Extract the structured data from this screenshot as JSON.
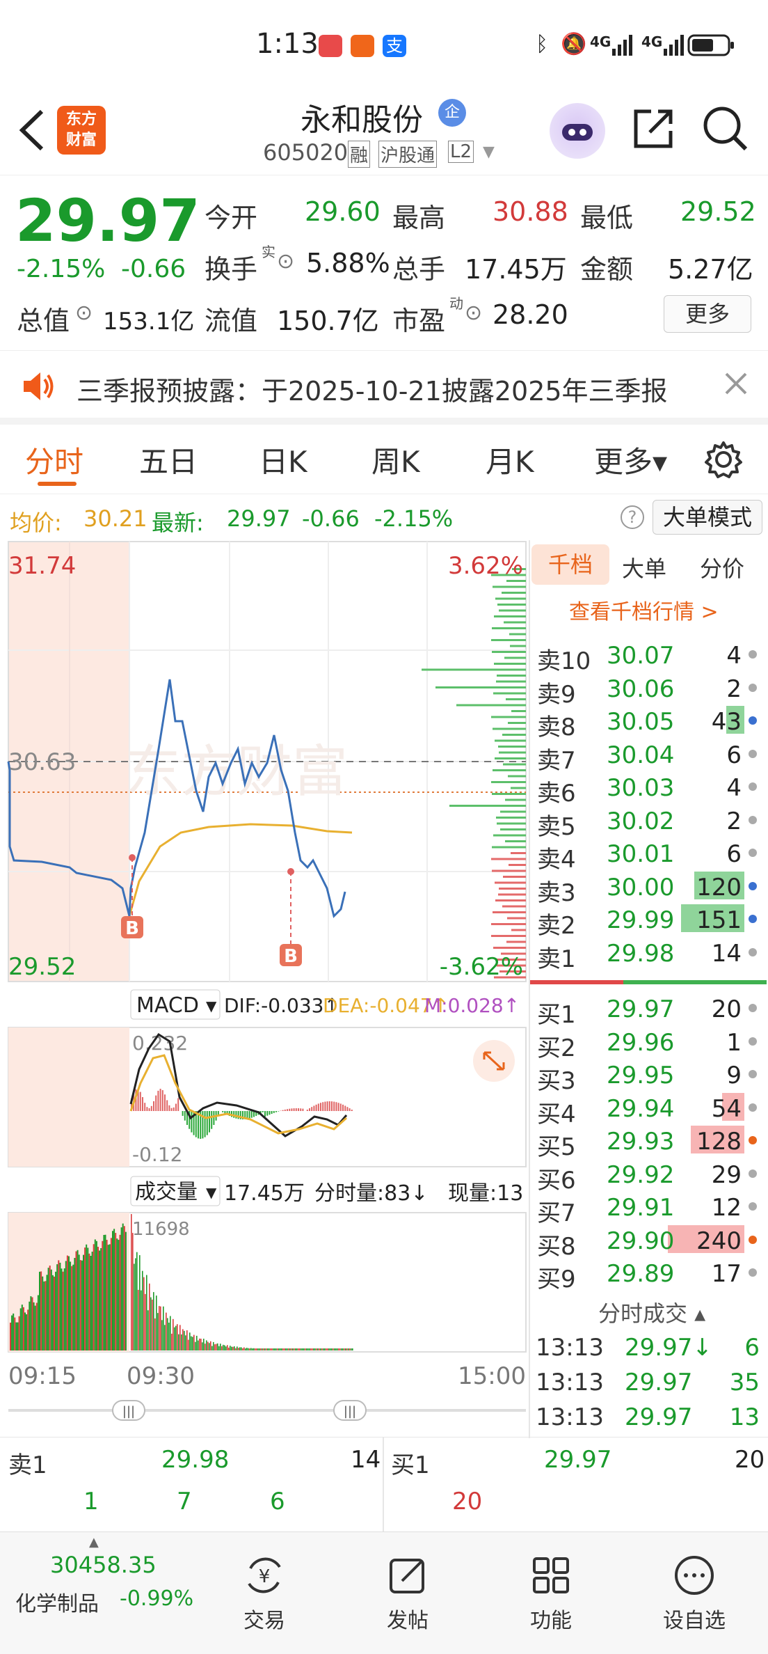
{
  "status": {
    "time": "1:13",
    "signal1": "4G",
    "signal2": "4G"
  },
  "nav": {
    "logo": "东方\n财富",
    "title": "永和股份",
    "corp_badge": "企",
    "code": "605020",
    "tag1": "融",
    "tag2": "沪股通",
    "tag3": "L2"
  },
  "quote": {
    "price": "29.97",
    "pct": "-2.15%",
    "chg": "-0.66",
    "open_label": "今开",
    "open": "29.60",
    "high_label": "最高",
    "high": "30.88",
    "low_label": "最低",
    "low": "29.52",
    "turnover_label": "换手",
    "turnover_sup": "实",
    "turnover": "5.88%",
    "volume_label": "总手",
    "volume": "17.45万",
    "amount_label": "金额",
    "amount": "5.27亿",
    "mcap_label": "总值",
    "mcap": "153.1亿",
    "float_label": "流值",
    "float": "150.7亿",
    "pe_label": "市盈",
    "pe_sup": "动",
    "pe": "28.20",
    "more": "更多"
  },
  "notice": {
    "text": "三季报预披露：于2025-10-21披露2025年三季报"
  },
  "tabs": [
    "分时",
    "五日",
    "日K",
    "周K",
    "月K",
    "更多▾"
  ],
  "subhdr": {
    "avg_label": "均价:",
    "avg": "30.21",
    "last_label": "最新:",
    "last": "29.97",
    "chg": "-0.66",
    "pct": "-2.15%",
    "big_order": "大单模式"
  },
  "chart": {
    "top_price": "31.74",
    "top_pct": "3.62%",
    "mid_price": "30.63",
    "bot_price": "29.52",
    "bot_pct": "-3.62%",
    "watermark": "东方财富",
    "macd_label": "MACD",
    "dif": "DIF:-0.033↑",
    "dea": "DEA:-0.047↑",
    "m": "M:0.028↑",
    "macd_top": "0.232",
    "macd_bot": "-0.12",
    "vol_label": "成交量",
    "vol_total": "17.45万",
    "vol_min": "分时量:83↓",
    "vol_now": "现量:13",
    "vol_max": "11698",
    "t1": "09:15",
    "t2": "09:30",
    "t3": "15:00",
    "b_label": "B"
  },
  "chart_data": {
    "type": "line",
    "title": "",
    "x": [
      "09:15",
      "09:30",
      "15:00"
    ],
    "ylim": [
      29.52,
      31.74
    ],
    "series": [
      {
        "name": "最新",
        "values": [
          30.63,
          30.18,
          30.12,
          30.05,
          29.6,
          30.48,
          30.4,
          30.25,
          30.05,
          29.88,
          29.97
        ]
      },
      {
        "name": "均价",
        "values": [
          29.7,
          30.1,
          30.21,
          30.21
        ]
      }
    ]
  },
  "orderbook": {
    "tabs": [
      "千档",
      "大单",
      "分价"
    ],
    "link": "查看千档行情 >",
    "asks": [
      {
        "label": "卖10",
        "price": "30.07",
        "qty": "4"
      },
      {
        "label": "卖9",
        "price": "30.06",
        "qty": "2"
      },
      {
        "label": "卖8",
        "price": "30.05",
        "qty": "43"
      },
      {
        "label": "卖7",
        "price": "30.04",
        "qty": "6"
      },
      {
        "label": "卖6",
        "price": "30.03",
        "qty": "4"
      },
      {
        "label": "卖5",
        "price": "30.02",
        "qty": "2"
      },
      {
        "label": "卖4",
        "price": "30.01",
        "qty": "6"
      },
      {
        "label": "卖3",
        "price": "30.00",
        "qty": "120"
      },
      {
        "label": "卖2",
        "price": "29.99",
        "qty": "151"
      },
      {
        "label": "卖1",
        "price": "29.98",
        "qty": "14"
      }
    ],
    "bids": [
      {
        "label": "买1",
        "price": "29.97",
        "qty": "20"
      },
      {
        "label": "买2",
        "price": "29.96",
        "qty": "1"
      },
      {
        "label": "买3",
        "price": "29.95",
        "qty": "9"
      },
      {
        "label": "买4",
        "price": "29.94",
        "qty": "54"
      },
      {
        "label": "买5",
        "price": "29.93",
        "qty": "128"
      },
      {
        "label": "买6",
        "price": "29.92",
        "qty": "29"
      },
      {
        "label": "买7",
        "price": "29.91",
        "qty": "12"
      },
      {
        "label": "买8",
        "price": "29.90",
        "qty": "240"
      },
      {
        "label": "买9",
        "price": "29.89",
        "qty": "17"
      }
    ],
    "trades_title": "分时成交 ▴",
    "trades": [
      {
        "time": "13:13",
        "price": "29.97↓",
        "qty": "6"
      },
      {
        "time": "13:13",
        "price": "29.97",
        "qty": "35"
      },
      {
        "time": "13:13",
        "price": "29.97",
        "qty": "13"
      }
    ]
  },
  "bottom": {
    "ask_label": "卖1",
    "ask_price": "29.98",
    "ask_qty": "14",
    "bid_label": "买1",
    "bid_price": "29.97",
    "bid_qty": "20",
    "ask_parts": [
      "1",
      "7",
      "6"
    ],
    "bid_parts": [
      "20"
    ]
  },
  "tabbar": {
    "index_value": "30458.35",
    "index_name": "化学制品",
    "index_pct": "-0.99%",
    "items": [
      "交易",
      "发帖",
      "功能",
      "设自选"
    ]
  }
}
